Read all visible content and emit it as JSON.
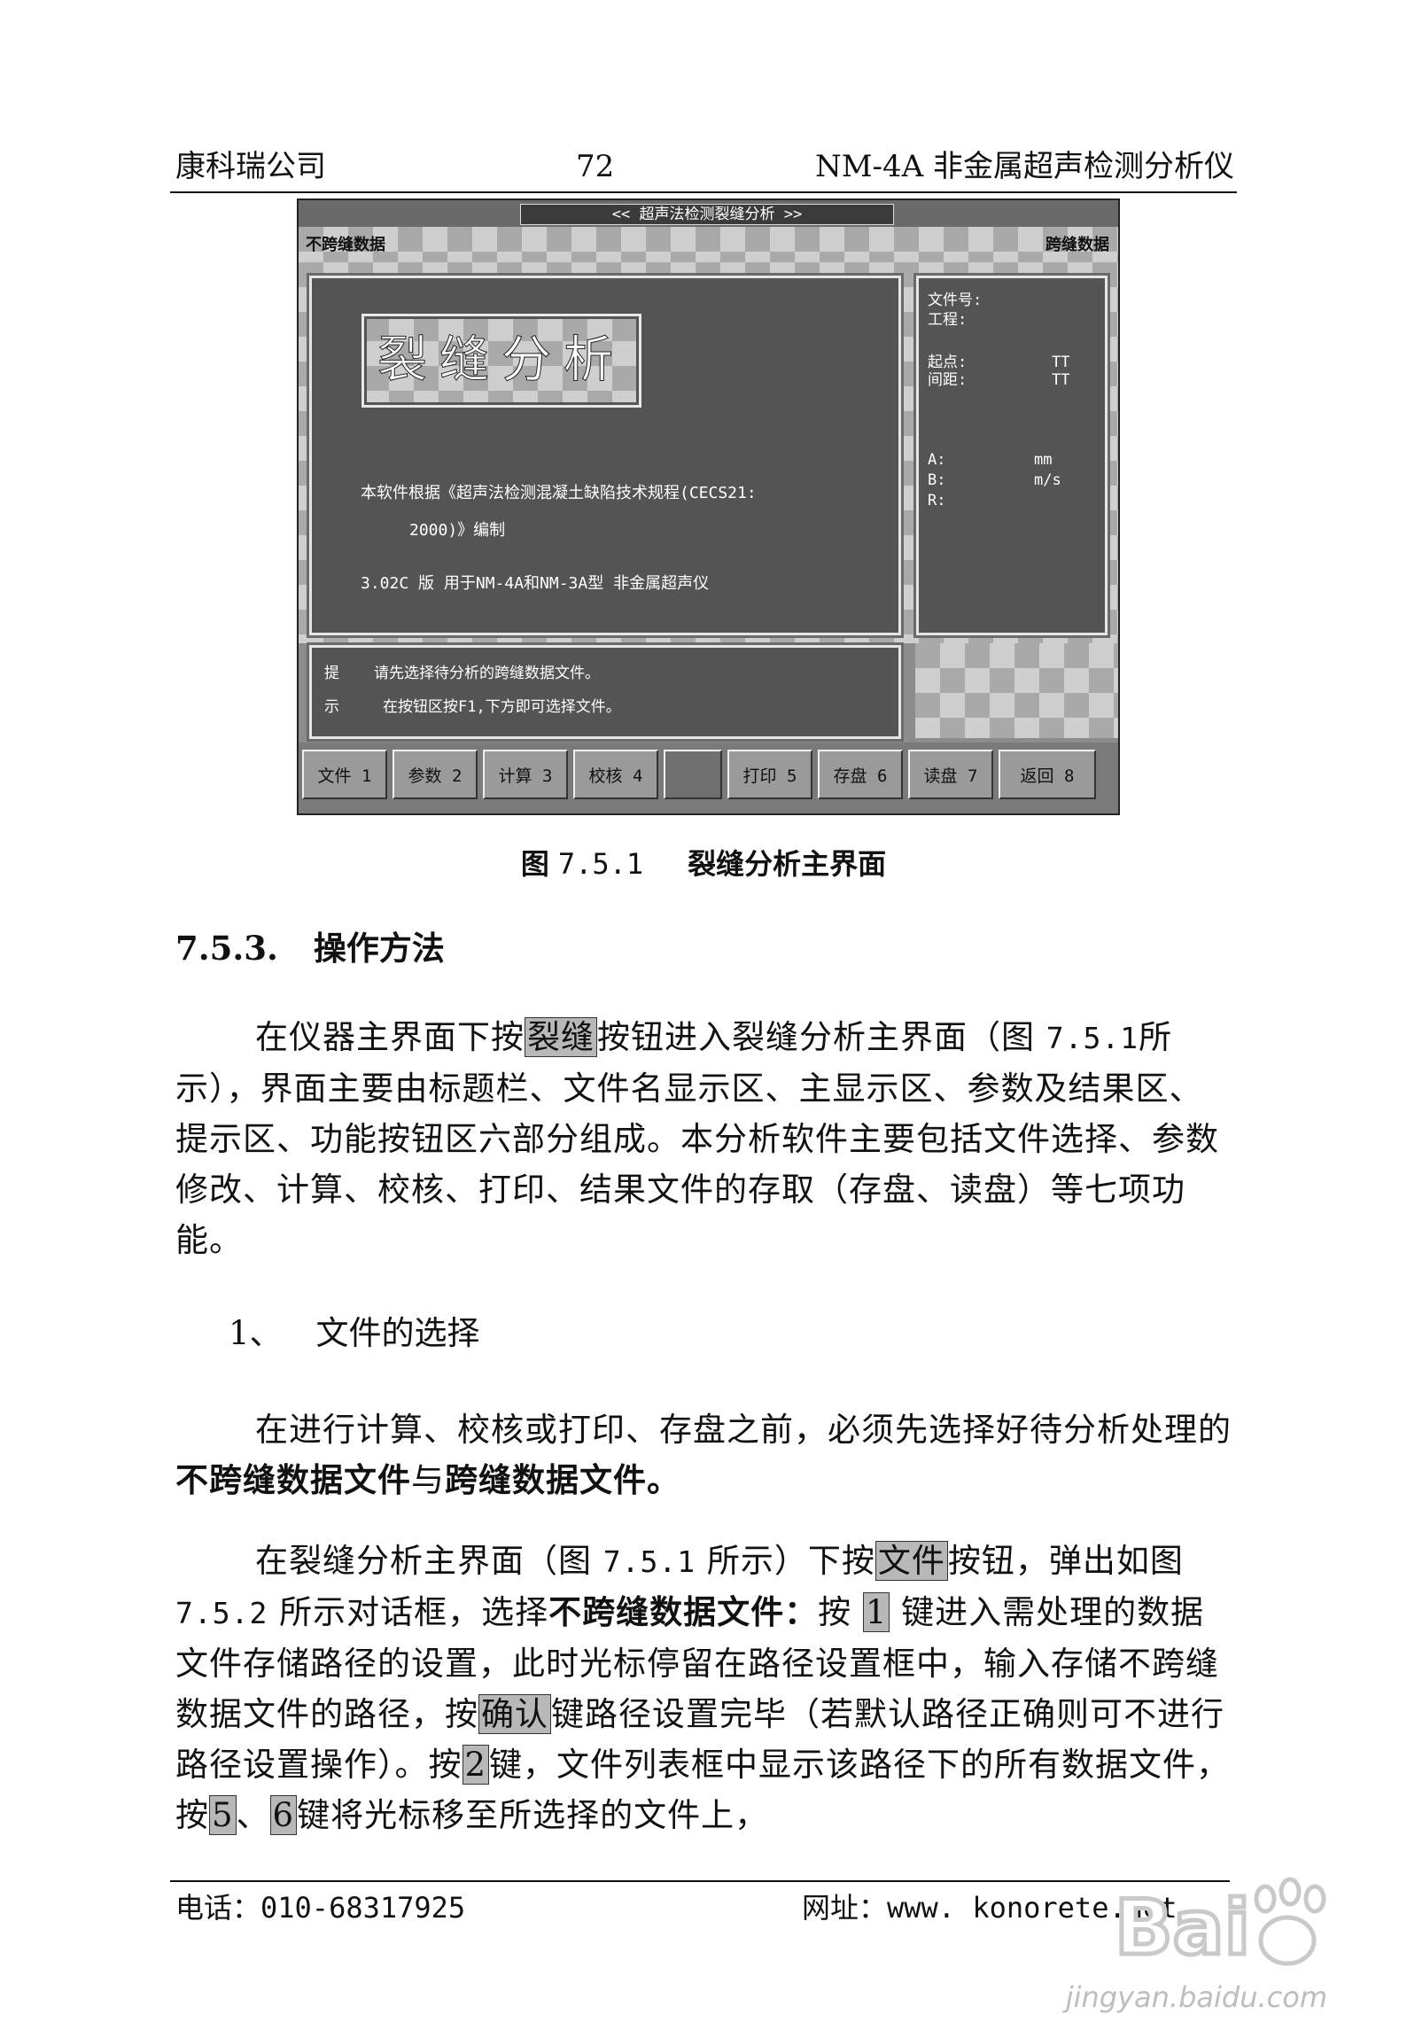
{
  "header": {
    "company": "康科瑞公司",
    "page_number": "72",
    "product": "NM-4A 非金属超声检测分析仪"
  },
  "figure": {
    "title": "<< 超声法检测裂缝分析 >>",
    "file_name_label": "不跨缝数据",
    "mode_label": "跨缝数据",
    "logo_text": "裂缝分析",
    "compile_line1": "本软件根据《超声法检测混凝土缺陷技术规程(CECS21:",
    "compile_line2": "2000)》编制",
    "version_line": "3.02C 版    用于NM-4A和NM-3A型  非金属超声仪",
    "side": {
      "file_no": "文件号:",
      "location": "工程:",
      "start": "起点:",
      "spacing": "间距:",
      "start_val": "TT",
      "spacing_val": "TT",
      "A": "A:",
      "A_unit": "mm",
      "B": "B:",
      "B_unit": "m/s",
      "R": "R:"
    },
    "hint": {
      "tag1": "提",
      "tag2": "示",
      "line1": "请先选择待分析的跨缝数据文件。",
      "line2": "在按钮区按F1,下方即可选择文件。"
    },
    "buttons": [
      {
        "label": "文件 1"
      },
      {
        "label": "参数 2"
      },
      {
        "label": "计算 3"
      },
      {
        "label": "校核 4"
      },
      {
        "label": ""
      },
      {
        "label": "打印 5"
      },
      {
        "label": "存盘 6"
      },
      {
        "label": "读盘 7"
      },
      {
        "label": "返回 8"
      }
    ]
  },
  "caption": {
    "prefix": "图",
    "number": "7.5.1",
    "text": "裂缝分析主界面"
  },
  "section": {
    "number": "7.5.3.",
    "title": "操作方法"
  },
  "para1": {
    "pre": "在仪器主界面下按",
    "key": "裂缝",
    "post1": "按钮进入裂缝分析主界面（图 ",
    "ref": "7.5.1",
    "post2": "所示），界面主要由标题栏、文件名显示区、主显示区、参数及结果区、提示区、功能按钮区六部分组成。本分析软件主要包括文件选择、参数修改、计算、校核、打印、结果文件的存取（存盘、读盘）等七项功能。"
  },
  "list_item": {
    "num": "1、",
    "label": "文件的选择"
  },
  "para2": {
    "pre": "在进行计算、校核或打印、存盘之前，必须先选择好待分析处理的",
    "bold1": "不跨缝数据文件",
    "mid": "与",
    "bold2": "跨缝数据文件。"
  },
  "para3": {
    "s1": "在裂缝分析主界面（图 ",
    "ref": "7.5.1",
    "s2": " 所示）下按",
    "k1": "文件",
    "s3": "按钮，弹出如图 ",
    "ref2": "7.5.2",
    "s4": " 所示对话框，选择",
    "b1": "不跨缝数据文件：",
    "s5": "按 ",
    "k2": "1",
    "s6": " 键进入需处理的数据文件存储路径的设置，此时光标停留在路径设置框中，输入存储不跨缝数据文件的路径，按",
    "k3": "确认",
    "s7": "键路径设置完毕（若默认路径正确则可不进行路径设置操作）。按",
    "k4": "2",
    "s8": "键，文件列表框中显示该路径下的所有数据文件，按",
    "k5": "5",
    "s9": "、",
    "k6": "6",
    "s10": "键将光标移至所选择的文件上，"
  },
  "footer": {
    "phone": "电话：010-68317925",
    "website": "网址：www. konorete.net"
  },
  "watermark": {
    "brand": "Bai",
    "site": "jingyan.baidu.com"
  }
}
